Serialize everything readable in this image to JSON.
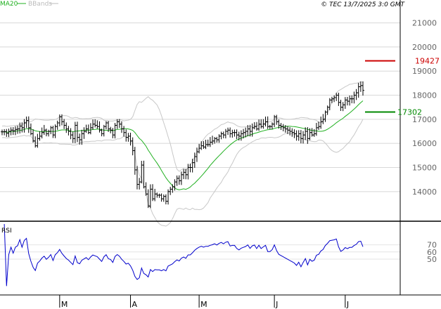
{
  "header": {
    "legend": [
      {
        "label": "MA20",
        "color": "#20b020"
      },
      {
        "label": "BBands",
        "color": "#bbbbbb"
      }
    ],
    "copyright": "© TEC 13/7/2025 3:0 GMT"
  },
  "chart_data": [
    {
      "type": "ohlc",
      "ylim": [
        12800,
        21600
      ],
      "y_ticks": [
        {
          "value": 21000,
          "label": "21000"
        },
        {
          "value": 20000,
          "label": "20000"
        },
        {
          "value": 19000,
          "label": "19000"
        },
        {
          "value": 18000,
          "label": "18000"
        },
        {
          "value": 17000,
          "label": "17000"
        },
        {
          "value": 16000,
          "label": "16000"
        },
        {
          "value": 15000,
          "label": "15000"
        },
        {
          "value": 14000,
          "label": "14000"
        }
      ],
      "x_ticks": [
        "M",
        "A",
        "M",
        "J",
        "J"
      ],
      "x_tick_bar_index": [
        26,
        58,
        89,
        123,
        155
      ],
      "close": [
        16480,
        16490,
        16420,
        16500,
        16550,
        16520,
        16580,
        16600,
        16720,
        16650,
        16850,
        16950,
        16650,
        16400,
        16100,
        15900,
        16200,
        16300,
        16450,
        16550,
        16400,
        16500,
        16650,
        16350,
        16700,
        16850,
        17100,
        16900,
        16750,
        16600,
        16500,
        16350,
        16200,
        16750,
        16250,
        16150,
        16400,
        16500,
        16600,
        16450,
        16650,
        16800,
        16750,
        16700,
        16550,
        16400,
        16700,
        16850,
        16600,
        16550,
        16350,
        16750,
        16900,
        16800,
        16600,
        16450,
        16250,
        16300,
        16100,
        15700,
        14900,
        14300,
        14400,
        15100,
        14200,
        13900,
        13400,
        14100,
        13700,
        13900,
        13850,
        13850,
        13700,
        13800,
        13600,
        14000,
        14100,
        14200,
        14400,
        14550,
        14450,
        14700,
        14800,
        14700,
        15000,
        15000,
        15200,
        15450,
        15650,
        15800,
        15900,
        15850,
        15950,
        15950,
        16050,
        16100,
        16200,
        16150,
        16300,
        16400,
        16350,
        16500,
        16550,
        16400,
        16450,
        16450,
        16350,
        16300,
        16400,
        16450,
        16500,
        16600,
        16500,
        16650,
        16700,
        16600,
        16800,
        16700,
        16800,
        16900,
        16700,
        16700,
        16800,
        17100,
        16900,
        16750,
        16700,
        16650,
        16600,
        16550,
        16500,
        16450,
        16400,
        16300,
        16400,
        16200,
        16350,
        16500,
        16200,
        16450,
        16350,
        16400,
        16650,
        16700,
        16900,
        17000,
        17300,
        17500,
        17800,
        17850,
        17900,
        18000,
        17700,
        17500,
        17600,
        17800,
        17750,
        17850,
        17850,
        18000,
        18100,
        18350,
        18400,
        18200
      ]
    },
    {
      "type": "line",
      "title": "RSI",
      "ylim": [
        0,
        100
      ],
      "y_ticks": [
        {
          "value": 70,
          "label": "70"
        },
        {
          "value": 60,
          "label": "60"
        },
        {
          "value": 50,
          "label": "50"
        }
      ]
    }
  ],
  "annotations": [
    {
      "value": 19427,
      "label": "19427",
      "color": "#cc0000"
    },
    {
      "value": 17302,
      "label": "17302",
      "color": "#008800"
    }
  ]
}
